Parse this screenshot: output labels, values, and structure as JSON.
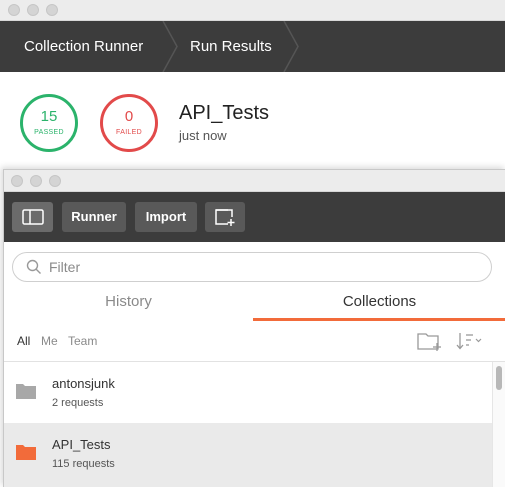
{
  "runner": {
    "breadcrumbs": [
      "Collection Runner",
      "Run Results"
    ],
    "passed": {
      "count": "15",
      "label": "PASSED",
      "color": "#2bb36b"
    },
    "failed": {
      "count": "0",
      "label": "FAILED",
      "color": "#e24a4a"
    },
    "collection_name": "API_Tests",
    "time": "just now"
  },
  "toolbar": {
    "sidebar_toggle_icon": "sidebar-layout-icon",
    "runner_label": "Runner",
    "import_label": "Import",
    "new_window_icon": "new-window-icon"
  },
  "search": {
    "placeholder": "Filter",
    "icon": "search-icon"
  },
  "tabs": [
    {
      "label": "History",
      "active": false
    },
    {
      "label": "Collections",
      "active": true
    }
  ],
  "scope_filters": [
    {
      "label": "All",
      "active": true
    },
    {
      "label": "Me",
      "active": false
    },
    {
      "label": "Team",
      "active": false
    }
  ],
  "collections": [
    {
      "name": "antonsjunk",
      "count": "2 requests",
      "selected": false
    },
    {
      "name": "API_Tests",
      "count": "115 requests",
      "selected": true
    }
  ],
  "colors": {
    "accent": "#f26b3a",
    "header_bg": "#3c3c3c",
    "button_bg": "#595959",
    "selected_row": "#eaeaea"
  }
}
